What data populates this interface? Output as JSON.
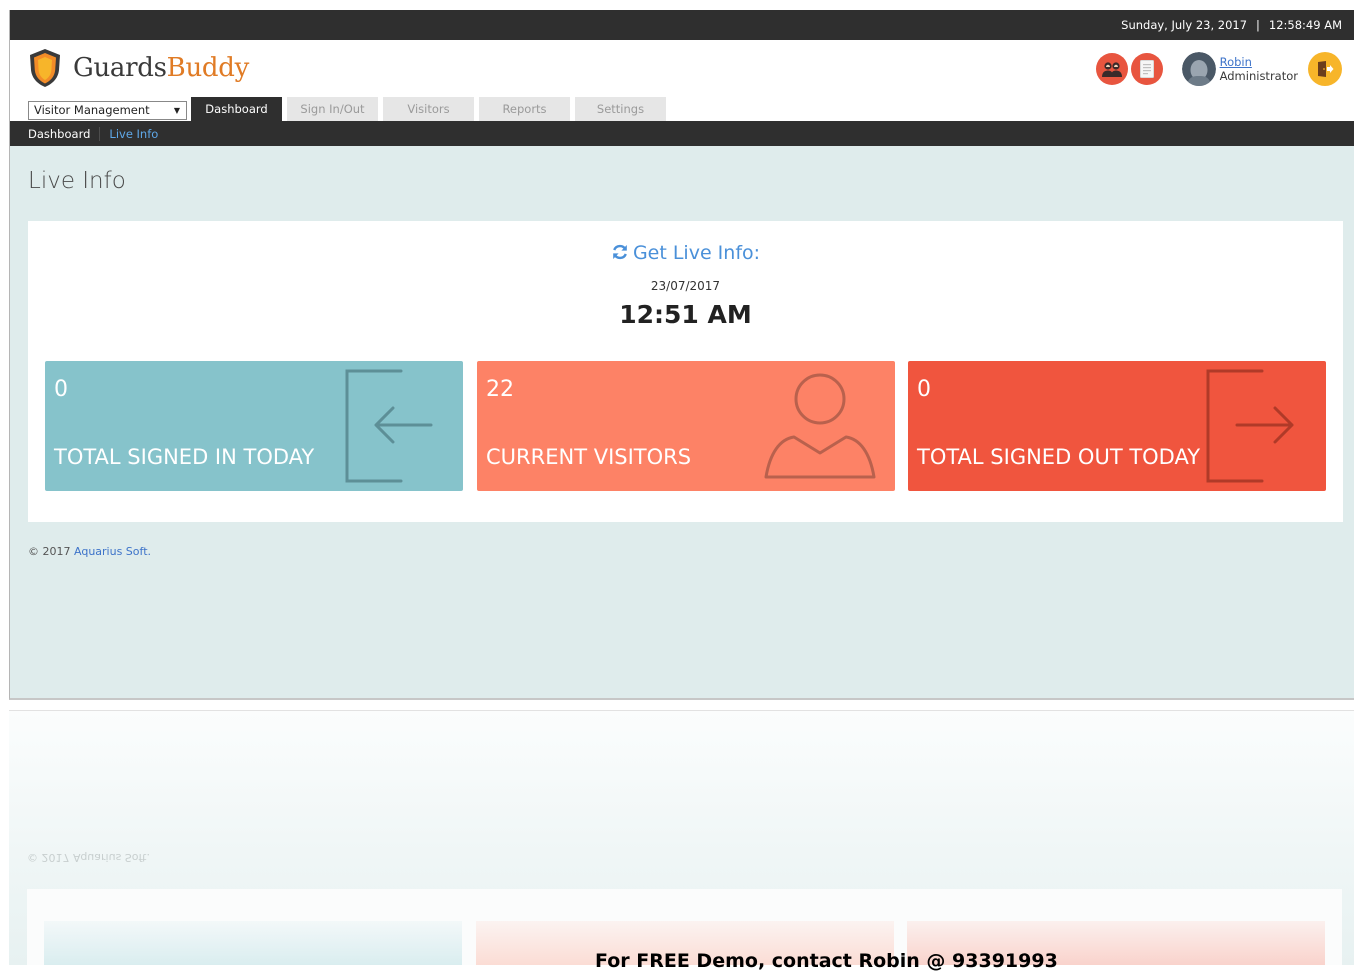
{
  "topbar": {
    "date": "Sunday, July 23, 2017",
    "separator": "|",
    "time": "12:58:49 AM"
  },
  "brand": {
    "name_part1": "Guards",
    "name_part2": "Buddy",
    "accent_color": "#e07b25"
  },
  "header": {
    "visitors_icon": "people-icon",
    "report_icon": "document-icon",
    "user": {
      "name": "Robin",
      "role": "Administrator"
    },
    "logout_icon": "exit-door-icon"
  },
  "module_select": {
    "selected": "Visitor Management"
  },
  "tabs": [
    {
      "label": "Dashboard",
      "active": true
    },
    {
      "label": "Sign In/Out",
      "active": false
    },
    {
      "label": "Visitors",
      "active": false
    },
    {
      "label": "Reports",
      "active": false
    },
    {
      "label": "Settings",
      "active": false
    }
  ],
  "breadcrumb": {
    "home": "Dashboard",
    "current": "Live Info"
  },
  "page": {
    "title": "Live Info"
  },
  "live": {
    "heading": "Get Live Info:",
    "refresh_icon": "refresh-icon",
    "date": "23/07/2017",
    "time": "12:51 AM"
  },
  "tiles": [
    {
      "count": "0",
      "label": "TOTAL SIGNED IN TODAY",
      "icon": "sign-in-icon",
      "color": "#86c3cb"
    },
    {
      "count": "22",
      "label": "CURRENT VISITORS",
      "icon": "user-icon",
      "color": "#fd8266"
    },
    {
      "count": "0",
      "label": "TOTAL SIGNED OUT TODAY",
      "icon": "sign-out-icon",
      "color": "#f0553e"
    }
  ],
  "footer": {
    "copyright": "© 2017",
    "company": "Aquarius Soft."
  },
  "reflection": {
    "copy_text": "© 2017 Aquarius Soft."
  },
  "demo_note": "For FREE Demo, contact Robin @ 93391993"
}
